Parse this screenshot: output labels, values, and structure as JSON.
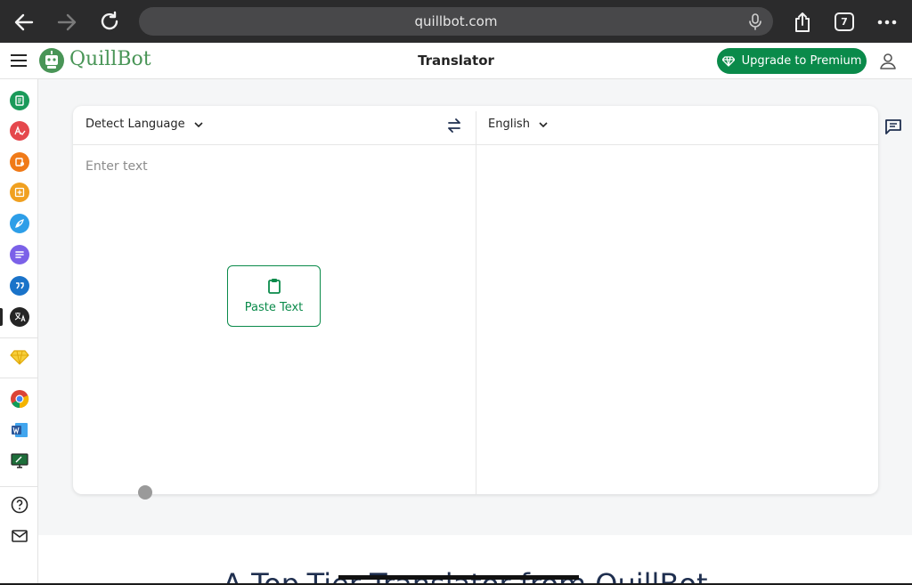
{
  "browser": {
    "url": "quillbot.com",
    "tab_count": "7"
  },
  "header": {
    "logo_text": "QuillBot",
    "title": "Translator",
    "premium_label": "Upgrade to Premium"
  },
  "sidebar": {
    "items": [
      {
        "icon": "paraphraser-icon",
        "color": "#1a9a5a"
      },
      {
        "icon": "grammar-checker-icon",
        "color": "#e5484d"
      },
      {
        "icon": "ai-detector-icon",
        "color": "#f07a18"
      },
      {
        "icon": "plagiarism-checker-icon",
        "color": "#f0a020"
      },
      {
        "icon": "ai-humanizer-icon",
        "color": "#2d9ee8"
      },
      {
        "icon": "summarizer-icon",
        "color": "#7b61e8"
      },
      {
        "icon": "citation-generator-icon",
        "color": "#1a73c9"
      },
      {
        "icon": "translator-icon",
        "color": "#252525"
      },
      {
        "icon": "premium-diamond-icon",
        "color": "#f2b90f"
      },
      {
        "icon": "chrome-extension-icon",
        "color": "#db4437"
      },
      {
        "icon": "word-addin-icon",
        "color": "#2b579a"
      },
      {
        "icon": "desktop-app-icon",
        "color": "#1d6e3a"
      },
      {
        "icon": "help-icon",
        "color": "#252525"
      },
      {
        "icon": "mail-icon",
        "color": "#252525"
      }
    ]
  },
  "translator": {
    "source_language": "Detect Language",
    "target_language": "English",
    "input_placeholder": "Enter text",
    "paste_label": "Paste Text"
  },
  "section": {
    "headline": "A Top-Tier Translator from QuillBot"
  },
  "colors": {
    "brand_green": "#0a8a4a",
    "logo_green": "#499557",
    "browser_bar": "#2b2b2c"
  }
}
